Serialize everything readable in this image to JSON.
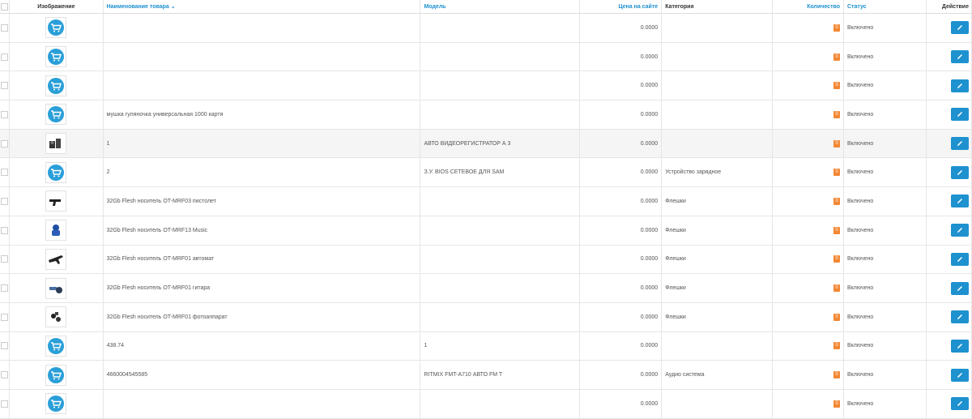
{
  "header": {
    "image": "Изображение",
    "name": "Наименование товара",
    "model": "Модель",
    "price": "Цена на сайте",
    "category": "Категория",
    "quantity": "Количество",
    "status": "Статус",
    "action": "Действие"
  },
  "rows": [
    {
      "thumb": "cart-placeholder-icon",
      "name": "",
      "model": "",
      "price": "0.0000",
      "category": "",
      "qty": "0",
      "status": "Включено"
    },
    {
      "thumb": "cart-placeholder-icon",
      "name": "",
      "model": "",
      "price": "0.0000",
      "category": "",
      "qty": "0",
      "status": "Включено"
    },
    {
      "thumb": "cart-placeholder-icon",
      "name": "",
      "model": "",
      "price": "0.0000",
      "category": "",
      "qty": "0",
      "status": "Включено"
    },
    {
      "thumb": "cart-placeholder-icon",
      "name": "мушка гуляночка универсальная 1000 картя",
      "model": "",
      "price": "0.0000",
      "category": "",
      "qty": "0",
      "status": "Включено"
    },
    {
      "thumb": "dashcam-photo",
      "name": "1",
      "model": "АВТО ВИДЕОРЕГИСТРАТОР А 3",
      "price": "0.0000",
      "category": "",
      "qty": "0",
      "status": "Включено"
    },
    {
      "thumb": "cart-placeholder-icon",
      "name": "2",
      "model": "З.У. BIOS СЕТЕВОЕ ДЛЯ SAM",
      "price": "0.0000",
      "category": "Устройство зарядное",
      "qty": "0",
      "status": "Включено"
    },
    {
      "thumb": "pistol-flash-photo",
      "name": "32Gb Flesh носитель OT-MRF03 пистолет",
      "model": "",
      "price": "0.0000",
      "category": "Флешки",
      "qty": "0",
      "status": "Включено"
    },
    {
      "thumb": "music-flash-photo",
      "name": "32Gb Flesh носитель OT-MRF13 Music",
      "model": "",
      "price": "0.0000",
      "category": "Флешки",
      "qty": "0",
      "status": "Включено"
    },
    {
      "thumb": "rifle-flash-photo",
      "name": "32Gb Flesh носитель OT-MRF01 автомат",
      "model": "",
      "price": "0.0000",
      "category": "Флешки",
      "qty": "0",
      "status": "Включено"
    },
    {
      "thumb": "guitar-flash-photo",
      "name": "32Gb Flesh носитель OT-MRF01 гитара",
      "model": "",
      "price": "0.0000",
      "category": "Флешки",
      "qty": "0",
      "status": "Включено"
    },
    {
      "thumb": "camera-flash-photo",
      "name": "32Gb Flesh носитель OT-MRF01 фотоаппарат",
      "model": "",
      "price": "0.0000",
      "category": "Флешки",
      "qty": "0",
      "status": "Включено"
    },
    {
      "thumb": "cart-placeholder-icon",
      "name": "438.74",
      "model": "1",
      "price": "0.0000",
      "category": "",
      "qty": "0",
      "status": "Включено"
    },
    {
      "thumb": "cart-placeholder-icon",
      "name": "4660004545585",
      "model": "RITMIX FMT-A710 АВТО FM T",
      "price": "0.0000",
      "category": "Аудио система",
      "qty": "0",
      "status": "Включено"
    },
    {
      "thumb": "cart-placeholder-icon",
      "name": "",
      "model": "",
      "price": "0.0000",
      "category": "",
      "qty": "0",
      "status": "Включено"
    }
  ],
  "colors": {
    "accent": "#1e91cf",
    "badge": "#f38733"
  }
}
